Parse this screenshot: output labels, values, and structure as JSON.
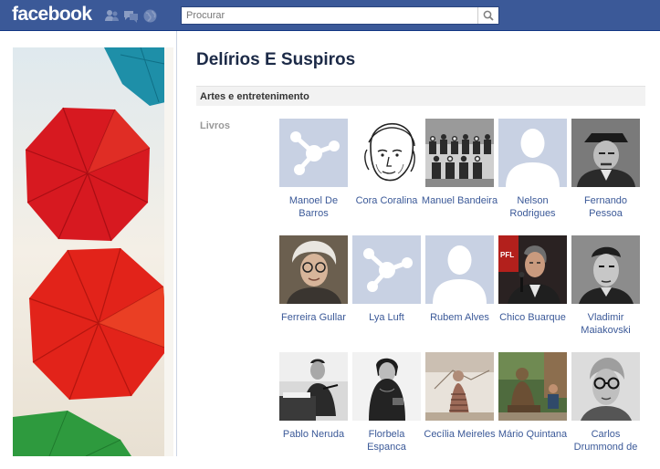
{
  "brand": {
    "logo_text": "facebook"
  },
  "topnav": {
    "jewels": [
      "friend-requests-icon",
      "messages-icon",
      "notifications-icon"
    ]
  },
  "search": {
    "placeholder": "Procurar",
    "value": ""
  },
  "page": {
    "title": "Delírios E Suspiros"
  },
  "section": {
    "title": "Artes e entretenimento"
  },
  "category": {
    "label": "Livros",
    "items": [
      {
        "name": "Manoel De Barros",
        "thumb": "default-page-icon"
      },
      {
        "name": "Cora Coralina",
        "thumb": "sketch-portrait"
      },
      {
        "name": "Manuel Bandeira",
        "thumb": "group-photo"
      },
      {
        "name": "Nelson Rodrigues",
        "thumb": "default-profile-silhouette"
      },
      {
        "name": "Fernando Pessoa",
        "thumb": "portrait-hat"
      },
      {
        "name": "Ferreira Gullar",
        "thumb": "portrait-glasses"
      },
      {
        "name": "Lya Luft",
        "thumb": "default-page-icon"
      },
      {
        "name": "Rubem Alves",
        "thumb": "default-profile-silhouette"
      },
      {
        "name": "Chico Buarque",
        "thumb": "portrait-microphone"
      },
      {
        "name": "Vladimir Maiakovski",
        "thumb": "portrait-bw"
      },
      {
        "name": "Pablo Neruda",
        "thumb": "portrait-desk"
      },
      {
        "name": "Florbela Espanca",
        "thumb": "portrait-woman"
      },
      {
        "name": "Cecília Meireles",
        "thumb": "illustration-woman"
      },
      {
        "name": "Mário Quintana",
        "thumb": "statue-photo"
      },
      {
        "name": "Carlos Drummond de",
        "thumb": "portrait-glasses-bw"
      }
    ]
  },
  "colors": {
    "topbar": "#3b5998",
    "link": "#3b5998",
    "title": "#1c2a47",
    "placeholder_thumb_bg": "#c8d1e3"
  }
}
